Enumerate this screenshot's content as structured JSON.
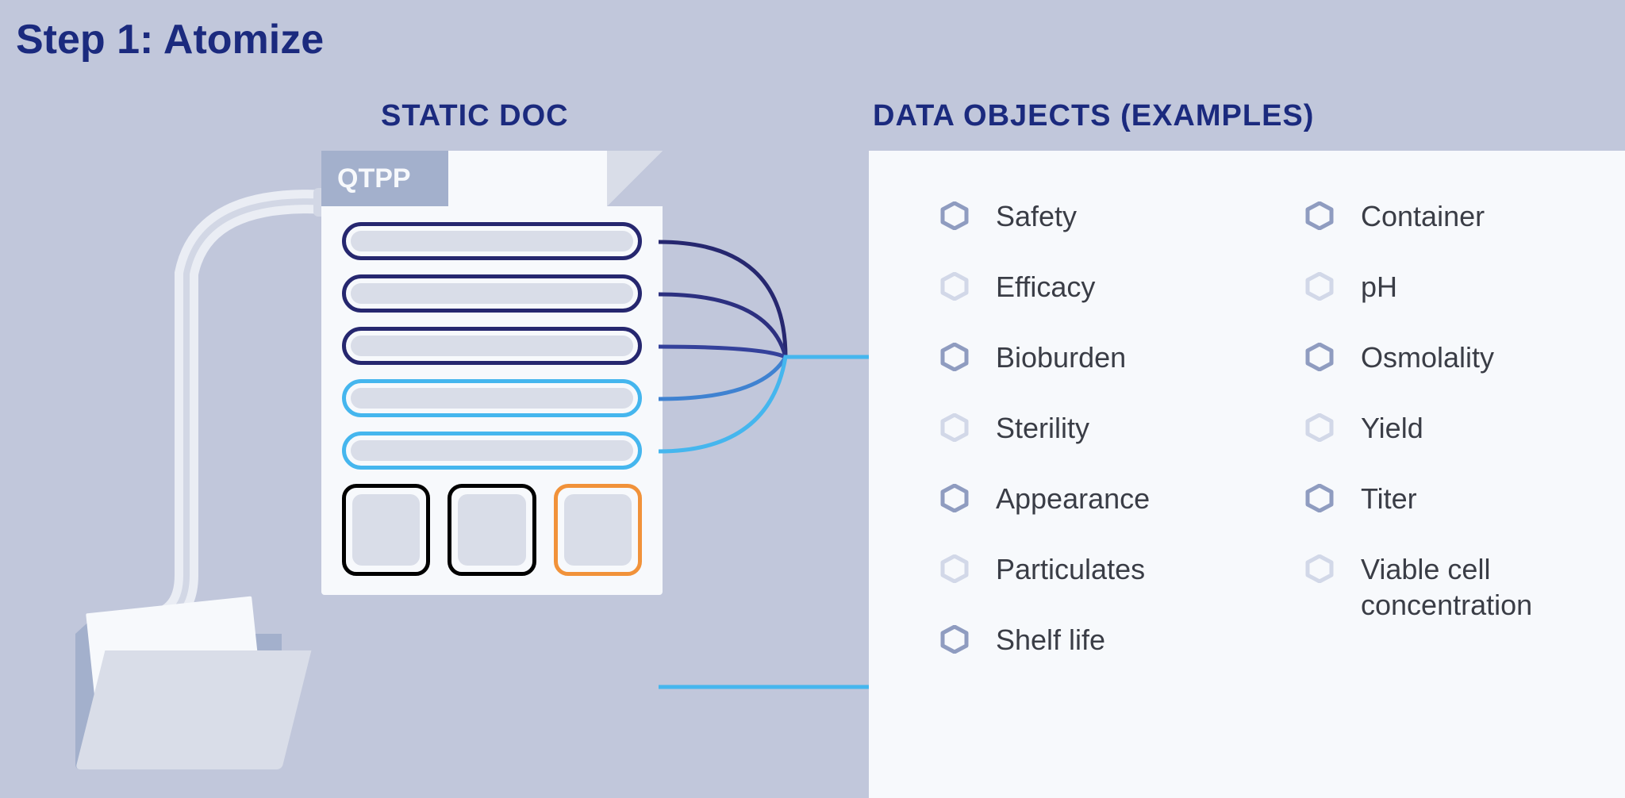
{
  "title": "Step 1: Atomize",
  "headings": {
    "static_doc": "STATIC DOC",
    "data_objects": "DATA OBJECTS (EXAMPLES)"
  },
  "doc": {
    "tab_label": "QTPP",
    "pills": [
      {
        "color": "navy"
      },
      {
        "color": "navy"
      },
      {
        "color": "navy"
      },
      {
        "color": "sky"
      },
      {
        "color": "sky"
      }
    ],
    "boxes": [
      {
        "color": "sky"
      },
      {
        "color": "sky"
      },
      {
        "color": "orange"
      }
    ]
  },
  "data_objects": {
    "column1": [
      {
        "label": "Safety",
        "hex": "solid"
      },
      {
        "label": "Efficacy",
        "hex": "light"
      },
      {
        "label": "Bioburden",
        "hex": "solid"
      },
      {
        "label": "Sterility",
        "hex": "light"
      },
      {
        "label": "Appearance",
        "hex": "solid"
      },
      {
        "label": "Particulates",
        "hex": "light"
      },
      {
        "label": "Shelf life",
        "hex": "solid"
      }
    ],
    "column2": [
      {
        "label": "Container",
        "hex": "solid"
      },
      {
        "label": "pH",
        "hex": "light"
      },
      {
        "label": "Osmolality",
        "hex": "solid"
      },
      {
        "label": "Yield",
        "hex": "light"
      },
      {
        "label": "Titer",
        "hex": "solid"
      },
      {
        "label": "Viable cell concentration",
        "hex": "light"
      }
    ]
  },
  "colors": {
    "navy": "#26276f",
    "sky": "#45b6ee",
    "orange": "#f1923a",
    "hex_solid": "#8f9cc0",
    "hex_light": "#d2d8e8"
  }
}
